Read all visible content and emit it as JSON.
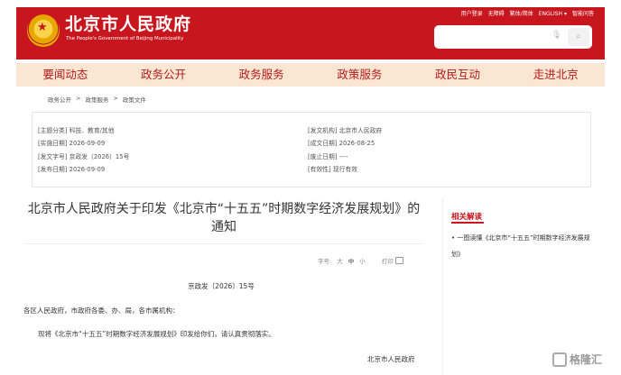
{
  "header": {
    "title": "北京市人民政府",
    "subtitle": "The People's Government of Beijing Municipality",
    "top_links": [
      "用户登录",
      "无障碍",
      "繁体/简体",
      "ENGLISH ▾",
      "智能问答"
    ]
  },
  "search": {
    "placeholder": ""
  },
  "nav": [
    "要闻动态",
    "政务公开",
    "政务服务",
    "政策服务",
    "政民互动",
    "走进北京"
  ],
  "breadcrumb": [
    "政务公开",
    ">",
    "政策服务",
    ">",
    "政策文件"
  ],
  "info": {
    "category": "[主题分类] 科技、教育/其他",
    "issuer": "[发文机构] 北京市人民政府",
    "impl_date": "[实施日期] 2026-09-09",
    "written_date": "[成文日期] 2026-08-25",
    "doc_no": "[发文字号] 京政发〔2026〕15号",
    "abolish_date": "[废止日期] ----",
    "pub_date": "[发布日期] 2026-09-09",
    "validity": "[有效性] 现行有效"
  },
  "article": {
    "title": "北京市人民政府关于印发《北京市“十五五”时期数字经济发展规划》的通知",
    "font_label": "字号:",
    "font_large": "大",
    "font_medium": "中",
    "font_small": "小",
    "print_label": "打印",
    "doc_number": "京政发〔2026〕15号",
    "salutation": "各区人民政府，市政府各委、办、局，各市属机构：",
    "body": "现将《北京市“十五五”时期数字经济发展规划》印发给你们，请认真贯彻落实。",
    "signature": "北京市人民政府"
  },
  "related": {
    "title": "相关解读",
    "link": "• 一图读懂《北京市“十五五”时期数字经济发展规划》"
  },
  "watermark": {
    "text": "格隆汇"
  }
}
